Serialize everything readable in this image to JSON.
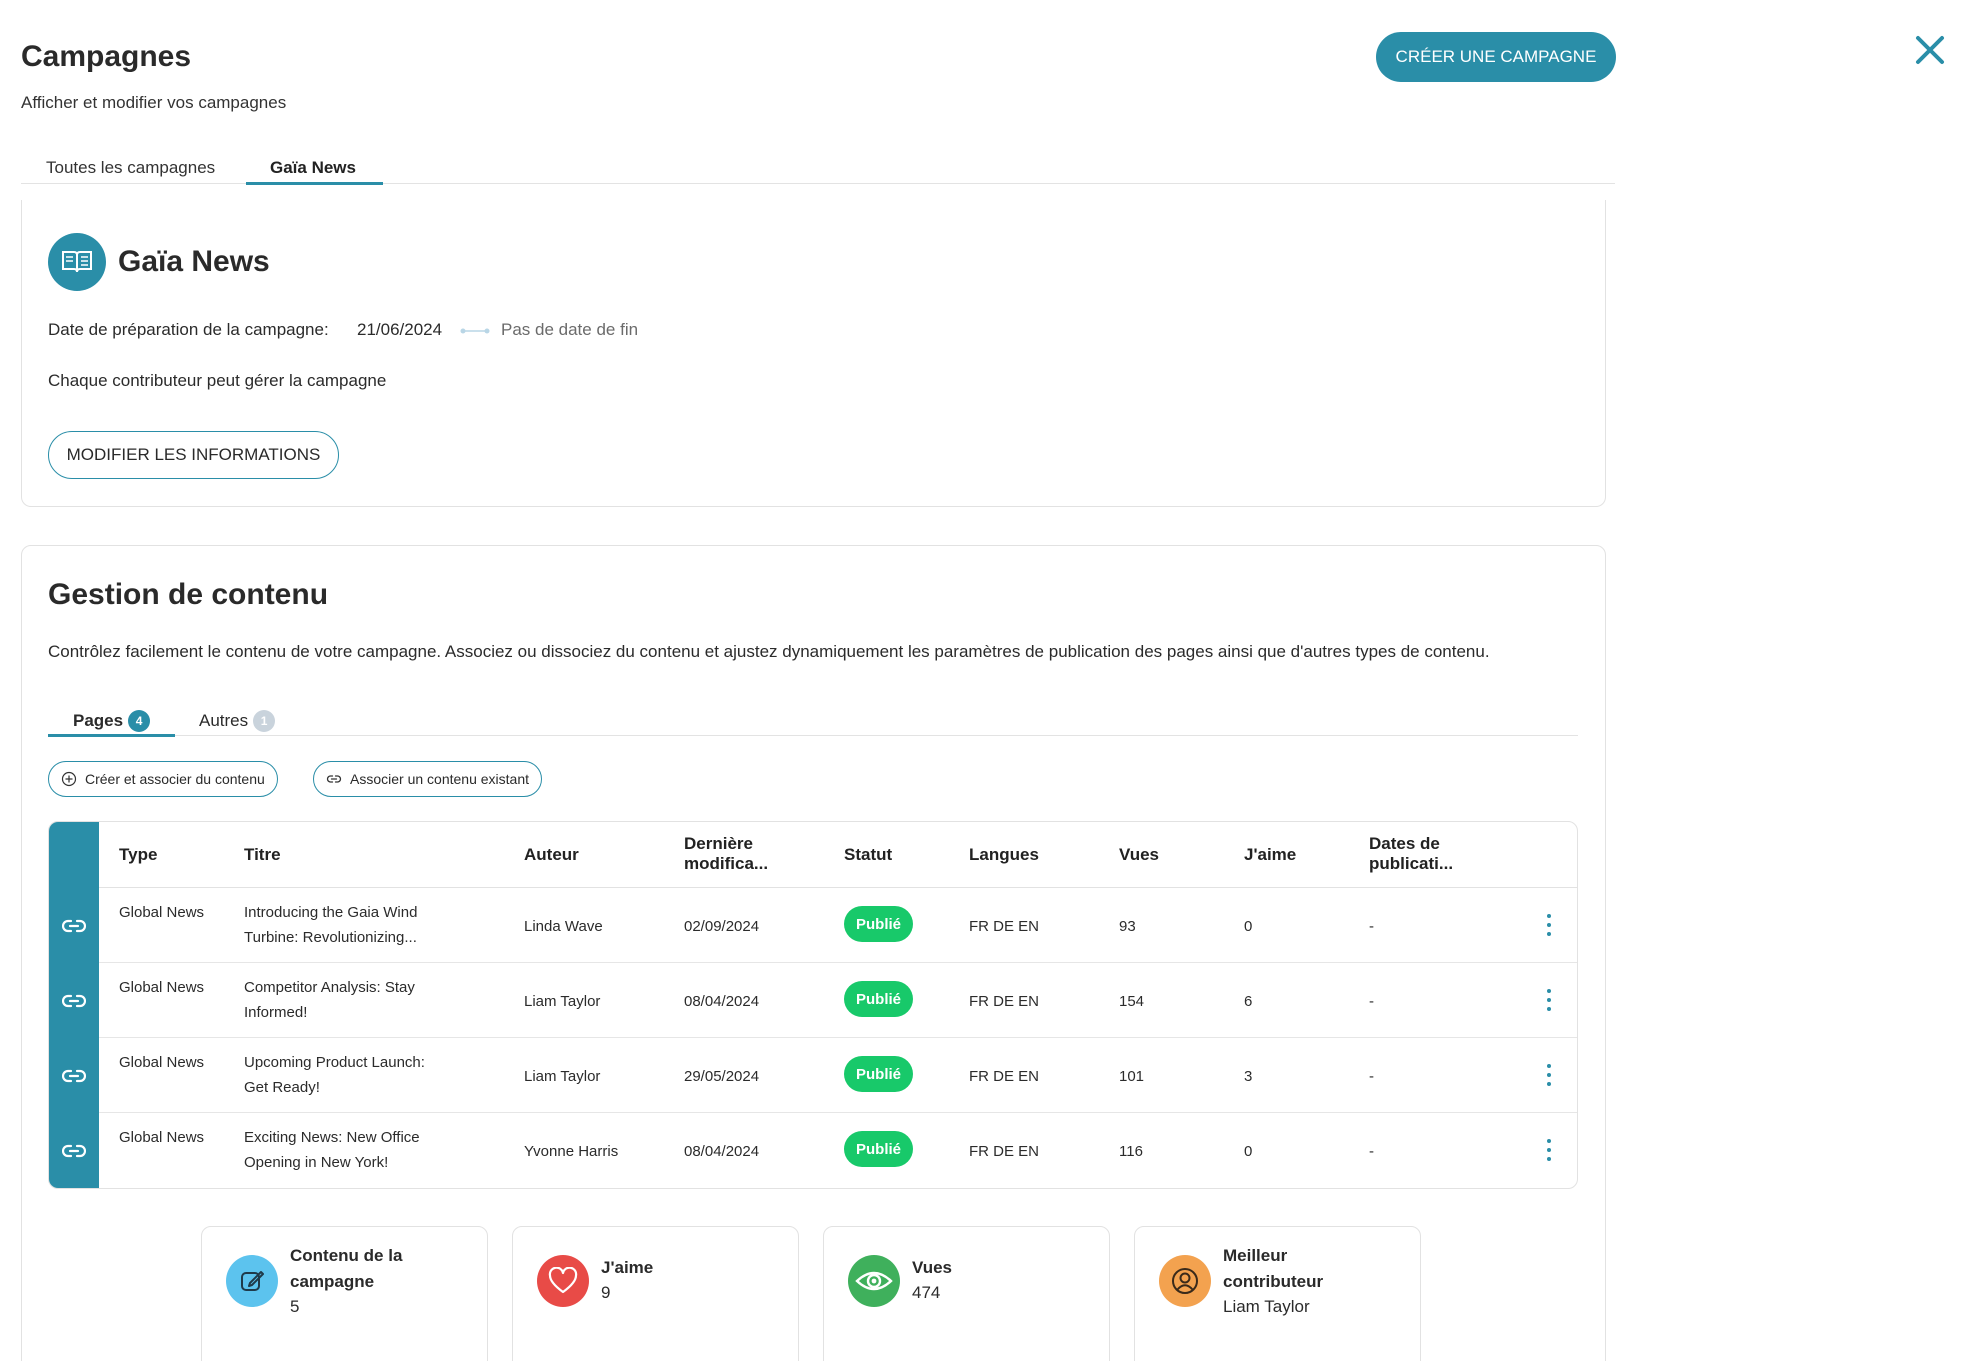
{
  "header": {
    "title": "Campagnes",
    "subtitle": "Afficher et modifier vos campagnes",
    "create_button": "CRÉER UNE CAMPAGNE"
  },
  "main_tabs": [
    {
      "label": "Toutes les campagnes",
      "active": false
    },
    {
      "label": "Gaïa News",
      "active": true
    }
  ],
  "campaign": {
    "name": "Gaïa News",
    "icon": "open-book-icon",
    "date_label": "Date de préparation de la campagne:",
    "date_start": "21/06/2024",
    "date_end": "Pas de date de fin",
    "permission": "Chaque contributeur peut gérer la campagne",
    "modify_button": "MODIFIER LES INFORMATIONS"
  },
  "content": {
    "title": "Gestion de contenu",
    "description": "Contrôlez facilement le contenu de votre campagne. Associez ou dissociez du contenu et ajustez dynamiquement les paramètres de publication des pages ainsi que d'autres types de contenu.",
    "tabs": [
      {
        "label": "Pages",
        "count": "4",
        "active": true
      },
      {
        "label": "Autres",
        "count": "1",
        "active": false
      }
    ],
    "create_associate_button": "Créer et associer du contenu",
    "associate_existing_button": "Associer un contenu existant",
    "table": {
      "headers": [
        "Type",
        "Titre",
        "Auteur",
        "Dernière modifica...",
        "Statut",
        "Langues",
        "Vues",
        "J'aime",
        "Dates de publicati..."
      ],
      "rows": [
        {
          "type": "Global News",
          "title": "Introducing the Gaia Wind Turbine: Revolutionizing...",
          "author": "Linda Wave",
          "modified": "02/09/2024",
          "status": "Publié",
          "languages": "FR DE EN",
          "views": "93",
          "likes": "0",
          "pub_dates": "-"
        },
        {
          "type": "Global News",
          "title": "Competitor Analysis: Stay Informed!",
          "author": "Liam Taylor",
          "modified": "08/04/2024",
          "status": "Publié",
          "languages": "FR DE EN",
          "views": "154",
          "likes": "6",
          "pub_dates": "-"
        },
        {
          "type": "Global News",
          "title": "Upcoming Product Launch: Get Ready!",
          "author": "Liam Taylor",
          "modified": "29/05/2024",
          "status": "Publié",
          "languages": "FR DE EN",
          "views": "101",
          "likes": "3",
          "pub_dates": "-"
        },
        {
          "type": "Global News",
          "title": "Exciting News: New Office Opening in New York!",
          "author": "Yvonne Harris",
          "modified": "08/04/2024",
          "status": "Publié",
          "languages": "FR DE EN",
          "views": "116",
          "likes": "0",
          "pub_dates": "-"
        }
      ]
    }
  },
  "stats": [
    {
      "label": "Contenu de la campagne",
      "value": "5",
      "icon": "edit-document-icon",
      "color": "#5cc3ee"
    },
    {
      "label": "J'aime",
      "value": "9",
      "icon": "heart-icon",
      "color": "#e84b47"
    },
    {
      "label": "Vues",
      "value": "474",
      "icon": "eye-icon",
      "color": "#3fb05c"
    },
    {
      "label": "Meilleur contributeur",
      "value": "Liam Taylor",
      "icon": "user-icon",
      "color": "#f3a24f"
    }
  ],
  "colors": {
    "accent": "#2a8ea8",
    "published": "#18c96a"
  }
}
